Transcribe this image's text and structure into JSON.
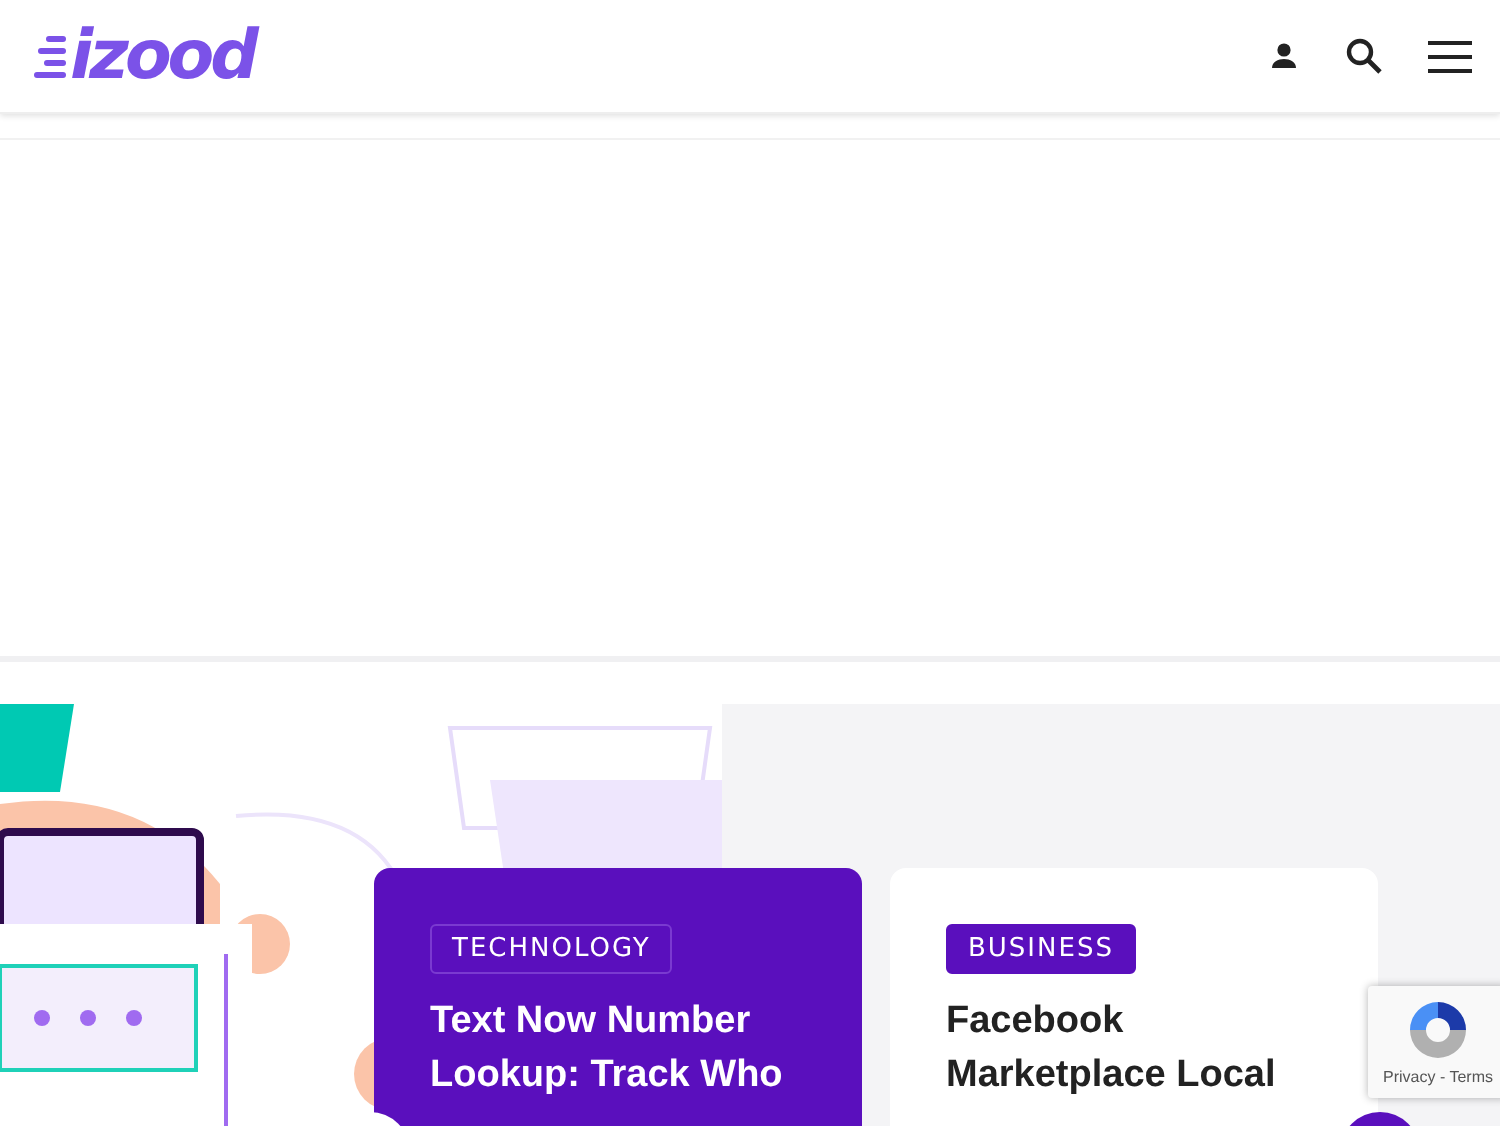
{
  "header": {
    "logo": "izood"
  },
  "cards": [
    {
      "kind": "featured",
      "category": "TECHNOLOGY",
      "title": "Text Now Number Lookup: Track Who"
    },
    {
      "kind": "plain",
      "category": "BUSINESS",
      "title": "Facebook Marketplace Local"
    }
  ],
  "recaptcha": {
    "links": "Privacy - Terms"
  }
}
